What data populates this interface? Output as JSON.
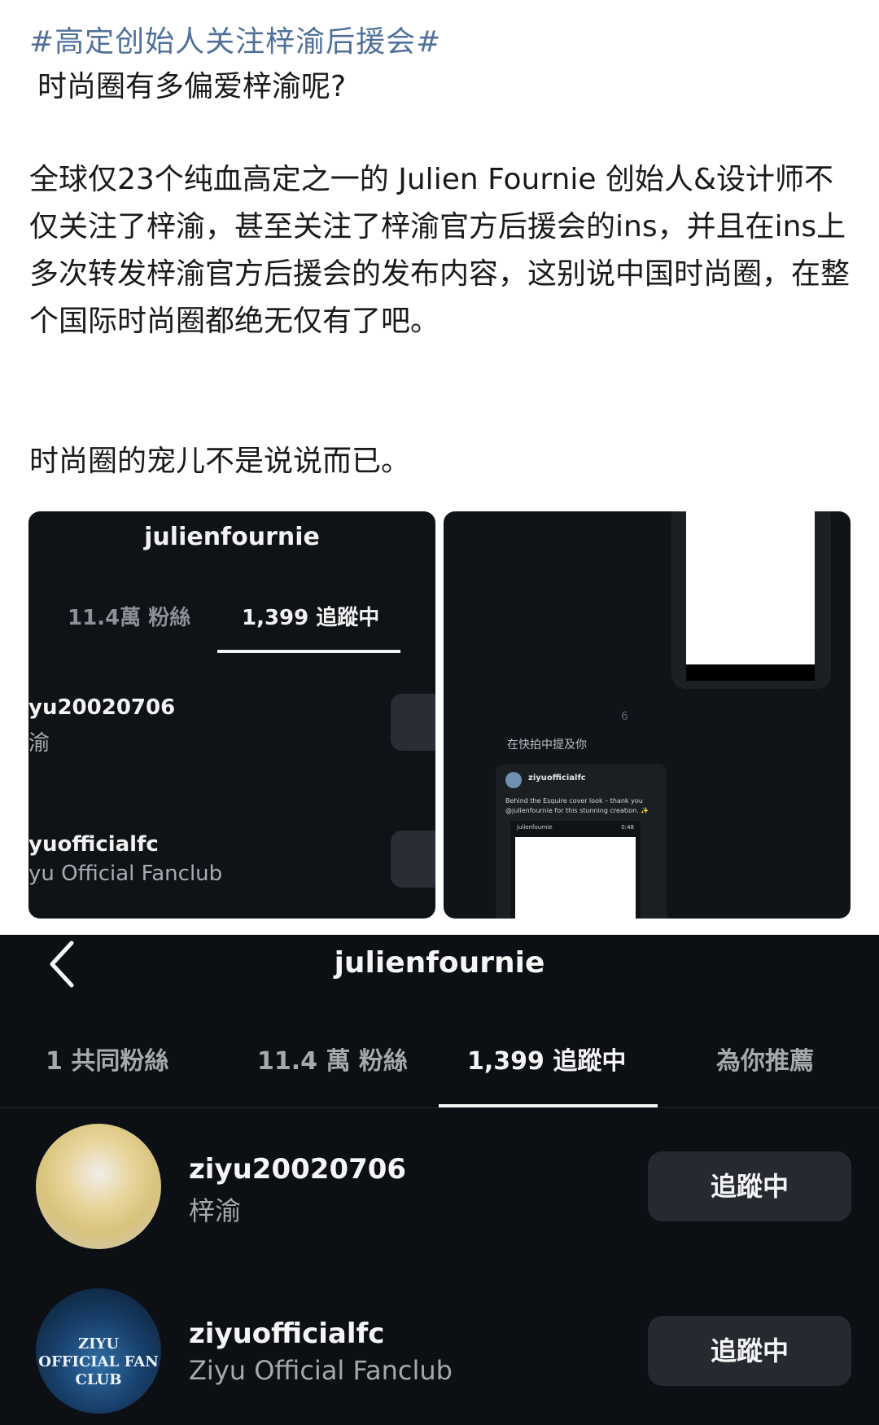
{
  "post": {
    "hashtag": "#高定创始人关注梓渝后援会#",
    "question": "时尚圈有多偏爱梓渝呢?",
    "paragraph1": "全球仅23个纯血高定之一的 Julien Fournie 创始人&设计师不仅关注了梓渝，甚至关注了梓渝官方后援会的ins，并且在ins上多次转发梓渝官方后援会的发布内容，这别说中国时尚圈，在整个国际时尚圈都绝无仅有了吧。",
    "paragraph2": "时尚圈的宠儿不是说说而已。"
  },
  "screenshot_left": {
    "title": "julienfournie",
    "tab_followers": "11.4萬 粉絲",
    "tab_following": "1,399 追蹤中",
    "user1": "yu20020706",
    "user1_sub": "渝",
    "user2": "yuofficialfc",
    "user2_sub": "yu Official Fanclub"
  },
  "screenshot_right": {
    "number": "6",
    "mention_text": "在快拍中提及你",
    "card_handle": "ziyuofficialfc",
    "card_caption": "Behind the Esquire cover look – thank you @julienfournie for this stunning creation. ✨",
    "inner_handle": "julienfournie",
    "inner_time": "0:48"
  },
  "instagram": {
    "title": "julienfournie",
    "tabs": [
      {
        "label": "1 共同粉絲"
      },
      {
        "label": "11.4 萬 粉絲"
      },
      {
        "label": "1,399 追蹤中"
      },
      {
        "label": "為你推薦"
      }
    ],
    "active_tab": "1,399 追蹤中",
    "following": [
      {
        "username": "ziyu20020706",
        "name": "梓渝",
        "button": "追蹤中"
      },
      {
        "username": "ziyuofficialfc",
        "name": "Ziyu Official Fanclub",
        "button": "追蹤中",
        "avatar_text": "ZIYU OFFICIAL FAN CLUB"
      }
    ]
  }
}
